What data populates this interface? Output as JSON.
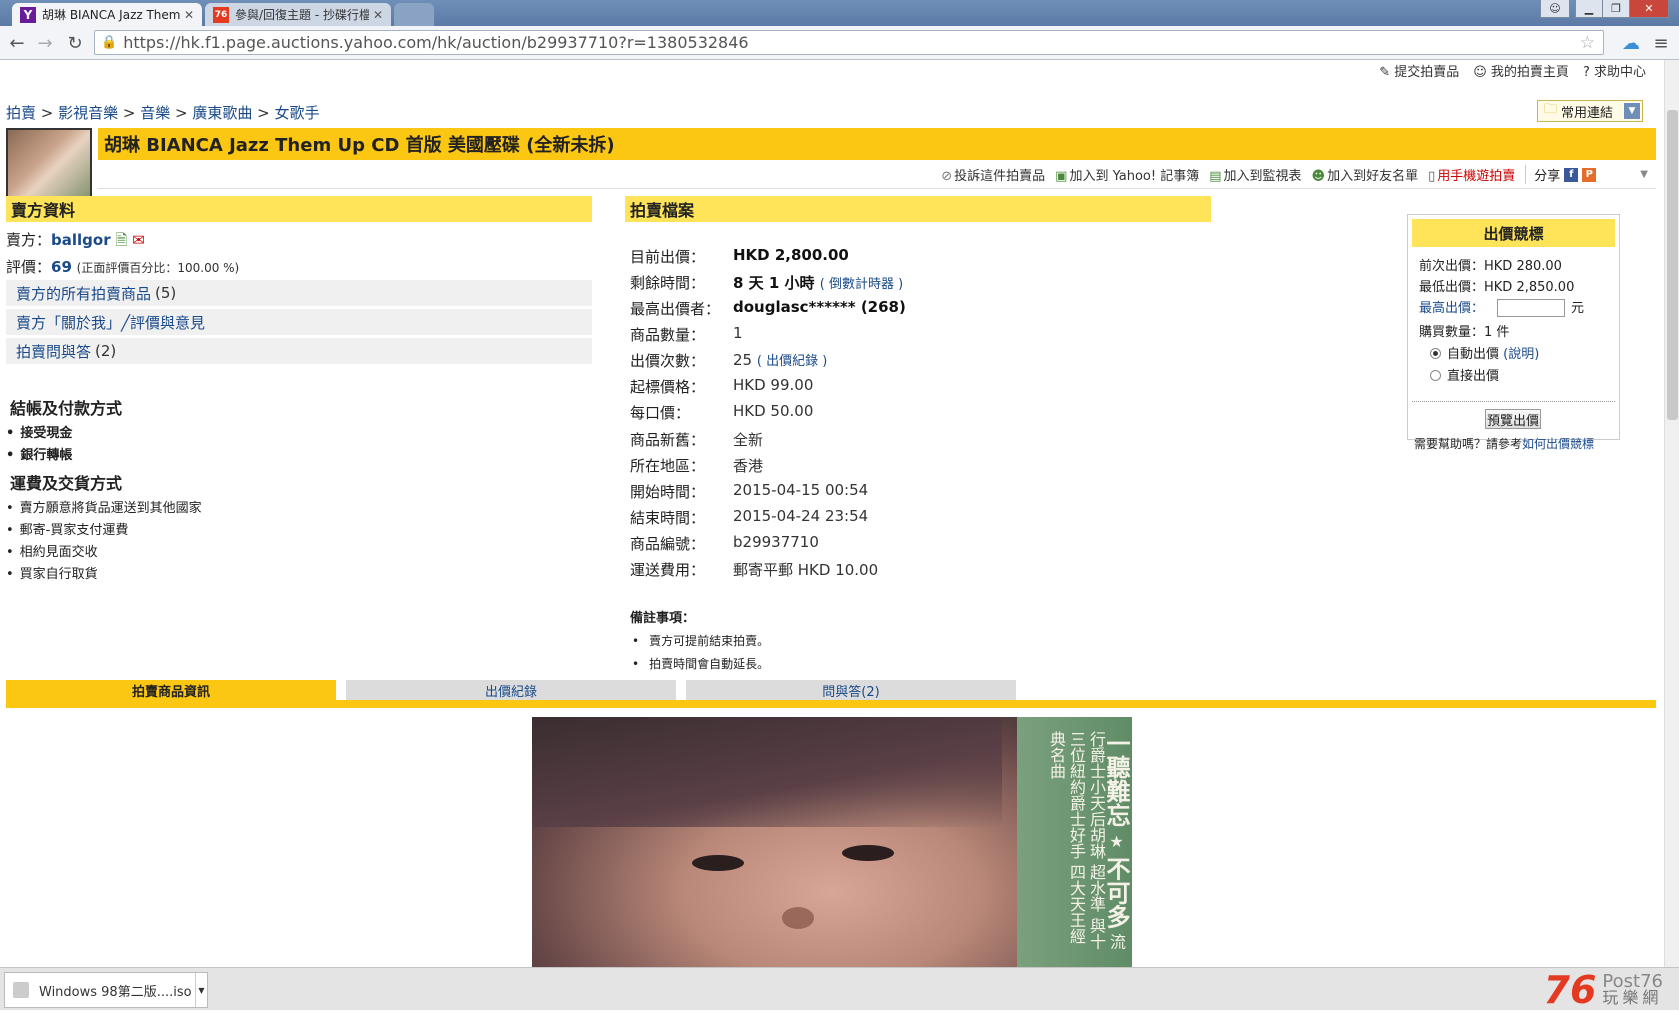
{
  "browser": {
    "tabs": [
      {
        "title": "胡琳 BIANCA Jazz Them",
        "favicon": "Y"
      },
      {
        "title": "參與/回復主題 - 抄碟行檔",
        "favicon": "76"
      }
    ],
    "url": "https://hk.f1.page.auctions.yahoo.com/hk/auction/b29937710?r=1380532846"
  },
  "top_links": [
    "提交拍賣品",
    "我的拍賣主頁",
    "求助中心"
  ],
  "breadcrumb": [
    "拍賣",
    "影視音樂",
    "音樂",
    "廣東歌曲",
    "女歌手"
  ],
  "favorites_dropdown": "常用連結",
  "item_title": "胡琳 BIANCA Jazz Them Up CD 首版 美國壓碟 (全新未拆)",
  "actions": {
    "report": "投訴這件拍賣品",
    "add_notebook": "加入到 Yahoo! 記事簿",
    "add_watch": "加入到監視表",
    "add_friend": "加入到好友名單",
    "mobile": "用手機遊拍賣",
    "share": "分享"
  },
  "seller": {
    "heading": "賣方資料",
    "seller_label": "賣方：",
    "seller_name": "ballgor",
    "rating_label": "評價：",
    "rating": "69",
    "positive": "(正面評價百分比：100.00 %)",
    "rows": [
      {
        "label": "賣方的所有拍賣商品",
        "count": "(5)"
      },
      {
        "label": "賣方「關於我」╱評價與意見",
        "count": ""
      },
      {
        "label": "拍賣問與答",
        "count": "(2)"
      }
    ],
    "payment_heading": "結帳及付款方式",
    "payment": [
      "接受現金",
      "銀行轉帳"
    ],
    "shipping_heading": "運費及交貨方式",
    "shipping": [
      "賣方願意將貨品運送到其他國家",
      "郵寄-買家支付運費",
      "相約見面交收",
      "買家自行取貨"
    ]
  },
  "auction": {
    "heading": "拍賣檔案",
    "current_bid_label": "目前出價：",
    "current_bid": "HKD 2,800.00",
    "time_left_label": "剩餘時間：",
    "time_left": "8 天 1 小時",
    "countdown_link": "( 倒數計時器 )",
    "highest_bidder_label": "最高出價者：",
    "highest_bidder": "douglasc****** (268)",
    "quantity_label": "商品數量：",
    "quantity": "1",
    "bids_label": "出價次數：",
    "bids": "25",
    "bid_history_link": "( 出價紀錄 )",
    "start_price_label": "起標價格：",
    "start_price": "HKD 99.00",
    "increment_label": "每口價：",
    "increment": "HKD 50.00",
    "condition_label": "商品新舊：",
    "condition": "全新",
    "location_label": "所在地區：",
    "location": "香港",
    "start_time_label": "開始時間：",
    "start_time": "2015-04-15 00:54",
    "end_time_label": "結束時間：",
    "end_time": "2015-04-24 23:54",
    "item_no_label": "商品編號：",
    "item_no": "b29937710",
    "shipping_label": "運送費用：",
    "shipping": "郵寄平郵 HKD 10.00",
    "notes_heading": "備註事項：",
    "notes": [
      "賣方可提前結束拍賣。",
      "拍賣時間會自動延長。"
    ]
  },
  "bidbox": {
    "heading": "出價競標",
    "prev_bid": "前次出價：HKD 280.00",
    "min_bid": "最低出價：HKD 2,850.00",
    "max_bid_label": "最高出價：",
    "currency_unit": "元",
    "qty": "購買數量：1 件",
    "auto_bid": "自動出價",
    "auto_bid_help": "(說明)",
    "direct_bid": "直接出價",
    "preview_button": "預覽出價",
    "help_text": "需要幫助嗎？請參考",
    "help_link": "如何出價競標"
  },
  "page_tabs": [
    "拍賣商品資訊",
    "出價紀錄",
    "問與答(2)"
  ],
  "cd_cover": {
    "title": "一聽難忘",
    "star": "★",
    "line1": "流行爵士小天后胡琳",
    "line2": "與十三位紐約爵士好手",
    "line3": "四大天王經典名曲",
    "partial1": "不可多",
    "partial2": "超水準"
  },
  "taskbar": {
    "download": "Windows 98第二版....iso"
  },
  "watermark": {
    "num": "76",
    "en": "Post76",
    "zh": "玩樂網"
  }
}
